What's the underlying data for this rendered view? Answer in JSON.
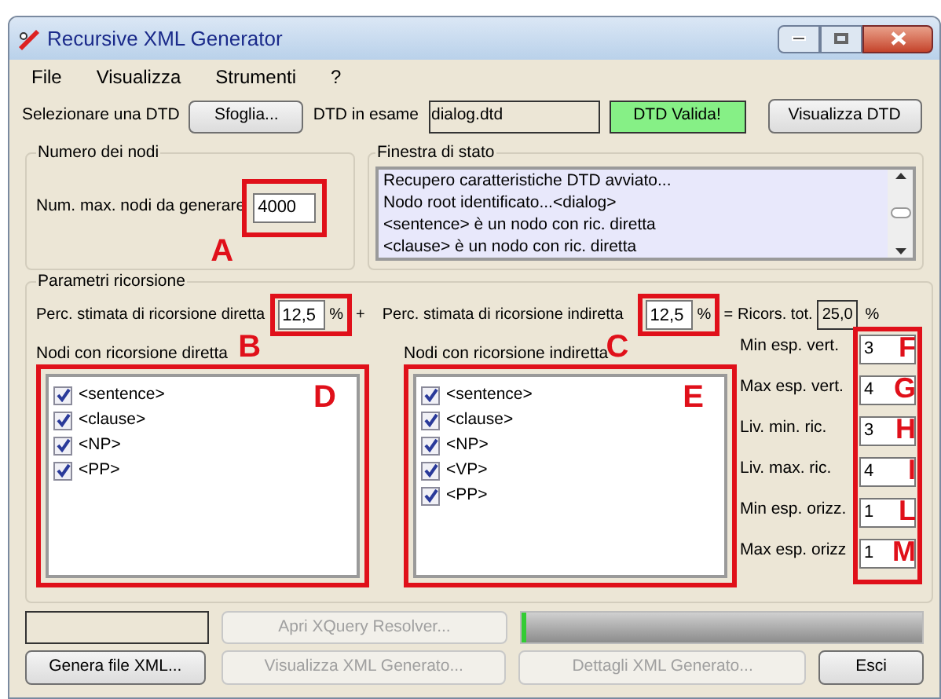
{
  "window": {
    "title": "Recursive XML Generator"
  },
  "menu": [
    {
      "label": "File"
    },
    {
      "label": "Visualizza"
    },
    {
      "label": "Strumenti"
    },
    {
      "label": "?"
    }
  ],
  "dtd_row": {
    "label": "Selezionare una DTD",
    "browse_button": "Sfoglia...",
    "file_label": "DTD in esame",
    "file_value": "dialog.dtd",
    "status": "DTD Valida!",
    "view_button": "Visualizza DTD"
  },
  "node_count": {
    "title": "Numero dei nodi",
    "label": "Num. max. nodi da generare",
    "value": "4000",
    "marker": "A"
  },
  "status_window": {
    "title": "Finestra di stato",
    "lines": [
      "Recupero caratteristiche DTD avviato...",
      "Nodo root identificato...<dialog>",
      "<sentence> è un nodo con ric. diretta",
      "<clause> è un nodo con ric. diretta"
    ]
  },
  "recursion": {
    "title": "Parametri ricorsione",
    "direct": {
      "label": "Perc. stimata di ricorsione diretta",
      "value": "12,5",
      "unit": "%",
      "marker": "B"
    },
    "plus": "+",
    "indirect": {
      "label": "Perc. stimata di ricorsione indiretta",
      "value": "12,5",
      "unit": "%",
      "marker": "C"
    },
    "equals": "=",
    "total": {
      "label": "Ricors. tot.",
      "value": "25,0",
      "unit": "%"
    },
    "direct_list": {
      "title": "Nodi con ricorsione diretta",
      "marker": "D",
      "items": [
        {
          "label": "<sentence>",
          "checked": true
        },
        {
          "label": "<clause>",
          "checked": true
        },
        {
          "label": "<NP>",
          "checked": true
        },
        {
          "label": "<PP>",
          "checked": true
        }
      ]
    },
    "indirect_list": {
      "title": "Nodi con ricorsione indiretta",
      "marker": "E",
      "items": [
        {
          "label": "<sentence>",
          "checked": true
        },
        {
          "label": "<clause>",
          "checked": true
        },
        {
          "label": "<NP>",
          "checked": true
        },
        {
          "label": "<VP>",
          "checked": true
        },
        {
          "label": "<PP>",
          "checked": true
        }
      ]
    },
    "fields": [
      {
        "label": "Min esp. vert.",
        "value": "3",
        "marker": "F"
      },
      {
        "label": "Max esp. vert.",
        "value": "4",
        "marker": "G"
      },
      {
        "label": "Liv. min. ric.",
        "value": "3",
        "marker": "H"
      },
      {
        "label": "Liv. max. ric.",
        "value": "4",
        "marker": "I"
      },
      {
        "label": "Min esp. orizz.",
        "value": "1",
        "marker": "L"
      },
      {
        "label": "Max esp. orizz",
        "value": "1",
        "marker": "M"
      }
    ]
  },
  "bottom": {
    "xquery_button": {
      "label": "Apri XQuery Resolver...",
      "disabled": true
    },
    "progress": {
      "level": 0.01
    },
    "buttons": [
      {
        "label": "Genera file XML...",
        "disabled": false
      },
      {
        "label": "Visualizza XML Generato...",
        "disabled": true
      },
      {
        "label": "Dettagli XML Generato...",
        "disabled": true
      },
      {
        "label": "Esci",
        "disabled": false
      }
    ]
  }
}
